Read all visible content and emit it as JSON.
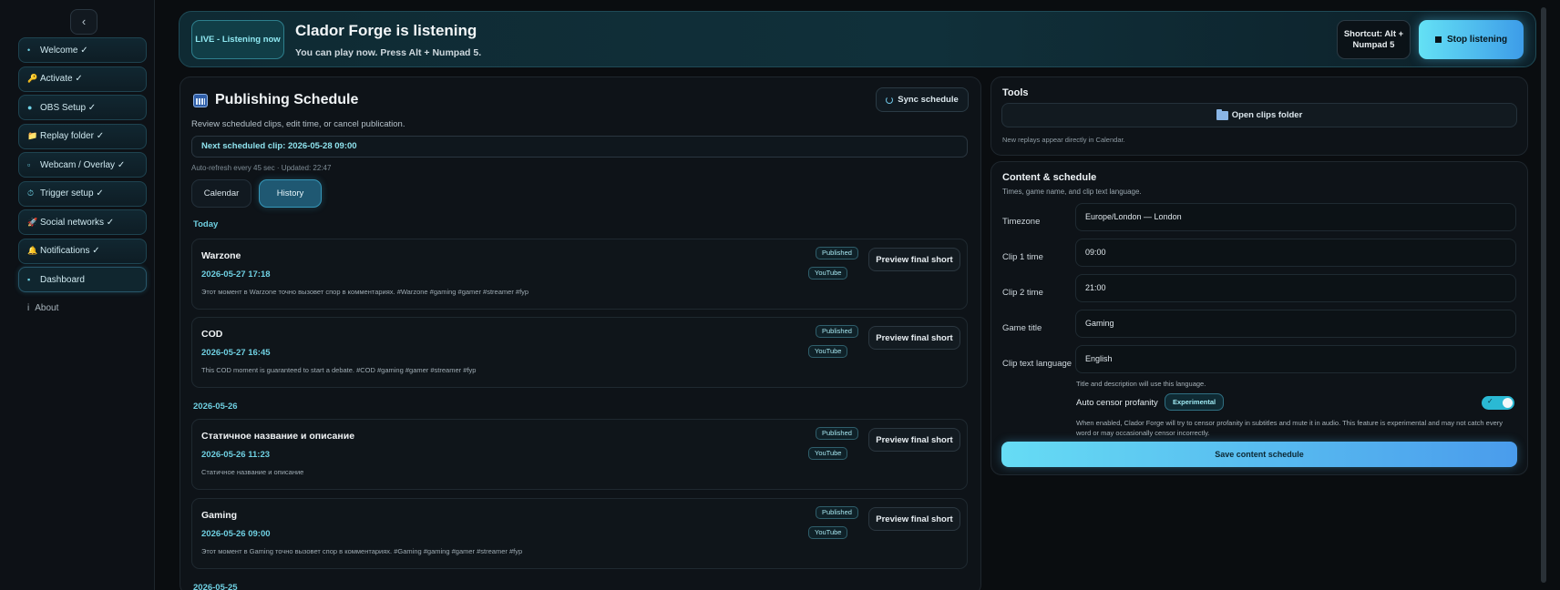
{
  "sidebar": {
    "collapse_icon": "‹",
    "items": [
      {
        "label": "Welcome ✓",
        "icon": "•"
      },
      {
        "label": "Activate ✓",
        "icon": "🔑"
      },
      {
        "label": "OBS Setup ✓",
        "icon": "●"
      },
      {
        "label": "Replay folder ✓",
        "icon": "📁"
      },
      {
        "label": "Webcam / Overlay ✓",
        "icon": "▫"
      },
      {
        "label": "Trigger setup ✓",
        "icon": "⏱"
      },
      {
        "label": "Social networks ✓",
        "icon": "🚀"
      },
      {
        "label": "Notifications ✓",
        "icon": "🔔"
      },
      {
        "label": "Dashboard",
        "icon": "▪"
      }
    ],
    "about": {
      "label": "About",
      "icon": "i"
    }
  },
  "banner": {
    "status_badge": "LIVE - Listening now",
    "title": "Clador Forge is listening",
    "subtitle": "You can play now. Press Alt + Numpad 5.",
    "shortcut_line1": "Shortcut: Alt +",
    "shortcut_line2": "Numpad 5",
    "stop_label": "Stop listening"
  },
  "schedule": {
    "title": "Publishing Schedule",
    "description": "Review scheduled clips, edit time, or cancel publication.",
    "sync_label": "Sync schedule",
    "next_clip": "Next scheduled clip: 2026-05-28 09:00",
    "refresh_note": "Auto-refresh every 45 sec · Updated: 22:47",
    "tabs": {
      "calendar": "Calendar",
      "history": "History"
    },
    "groups": [
      {
        "date": "Today",
        "clips": [
          {
            "title": "Warzone",
            "datetime": "2026-05-27 17:18",
            "description": "Этот момент в Warzone точно вызовет спор в комментариях. #Warzone #gaming #gamer #streamer #fyp",
            "status": "Published",
            "platform": "YouTube",
            "action": "Preview final short"
          },
          {
            "title": "COD",
            "datetime": "2026-05-27 16:45",
            "description": "This COD moment is guaranteed to start a debate. #COD #gaming #gamer #streamer #fyp",
            "status": "Published",
            "platform": "YouTube",
            "action": "Preview final short"
          }
        ]
      },
      {
        "date": "2026-05-26",
        "clips": [
          {
            "title": "Статичное название и описание",
            "datetime": "2026-05-26 11:23",
            "description": "Статичное название и описание",
            "status": "Published",
            "platform": "YouTube",
            "action": "Preview final short"
          },
          {
            "title": "Gaming",
            "datetime": "2026-05-26 09:00",
            "description": "Этот момент в Gaming точно вызовет спор в комментариях. #Gaming #gaming #gamer #streamer #fyp",
            "status": "Published",
            "platform": "YouTube",
            "action": "Preview final short"
          }
        ]
      },
      {
        "date": "2026-05-25",
        "clips": []
      }
    ]
  },
  "tools": {
    "title": "Tools",
    "open_clips_label": "Open clips folder",
    "note": "New replays appear directly in Calendar."
  },
  "content_schedule": {
    "title": "Content & schedule",
    "subtitle": "Times, game name, and clip text language.",
    "fields": [
      {
        "label": "Timezone",
        "value": "Europe/London — London"
      },
      {
        "label": "Clip 1 time",
        "value": "09:00"
      },
      {
        "label": "Clip 2 time",
        "value": "21:00"
      },
      {
        "label": "Game title",
        "value": "Gaming"
      },
      {
        "label": "Clip text language",
        "value": "English"
      }
    ],
    "language_note": "Title and description will use this language.",
    "censor_label": "Auto censor profanity",
    "experimental_badge": "Experimental",
    "censor_enabled": true,
    "censor_note": "When enabled, Clador Forge will try to censor profanity in subtitles and mute it in audio. This feature is experimental and may not catch every word or may occasionally censor incorrectly.",
    "save_label": "Save content schedule"
  },
  "colors": {
    "accent": "#4fd1e6",
    "background": "#0a0d10",
    "panel": "#0e1318",
    "banner": "#10303a"
  }
}
